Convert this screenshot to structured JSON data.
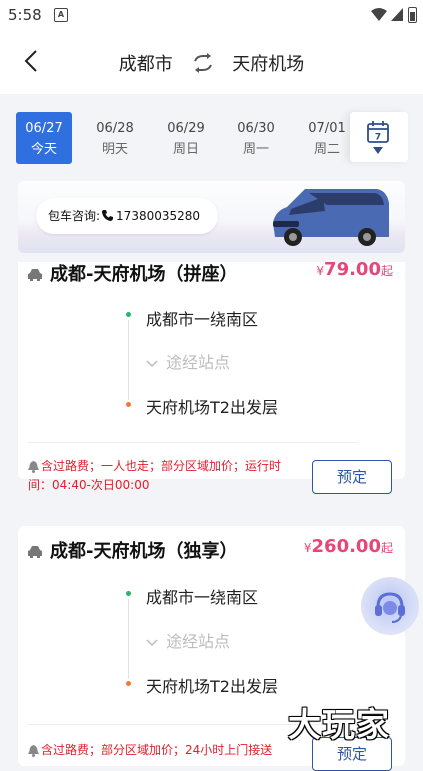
{
  "status_bar": {
    "time": "5:58",
    "notification_glyph": "A",
    "icons": [
      "wifi-icon",
      "signal-icon",
      "battery-icon"
    ]
  },
  "header": {
    "from": "成都市",
    "to": "天府机场"
  },
  "dates": [
    {
      "date": "06/27",
      "weekday": "今天",
      "active": true
    },
    {
      "date": "06/28",
      "weekday": "明天",
      "active": false
    },
    {
      "date": "06/29",
      "weekday": "周日",
      "active": false
    },
    {
      "date": "06/30",
      "weekday": "周一",
      "active": false
    },
    {
      "date": "07/01",
      "weekday": "周二",
      "active": false
    }
  ],
  "calendar": {
    "day": "7"
  },
  "banner": {
    "label": "包车咨询:",
    "phone": "17380035280"
  },
  "trips": [
    {
      "title": "成都-天府机场（拼座）",
      "currency": "¥",
      "price": "79.00",
      "suffix": "起",
      "origin": "成都市一绕南区",
      "via": "途经站点",
      "destination": "天府机场T2出发层",
      "note": "含过路费；一人也走；部分区域加价；运行时间：04:40-次日00:00",
      "book_label": "预定"
    },
    {
      "title": "成都-天府机场（独享）",
      "currency": "¥",
      "price": "260.00",
      "suffix": "起",
      "origin": "成都市一绕南区",
      "via": "途经站点",
      "destination": "天府机场T2出发层",
      "note": "含过路费；部分区域加价；24小时上门接送",
      "book_label": "预定"
    }
  ],
  "watermark": "大玩家",
  "colors": {
    "accent": "#2f6fe0",
    "price": "#e8457a",
    "note": "#e0202c",
    "button": "#2f55a8"
  }
}
